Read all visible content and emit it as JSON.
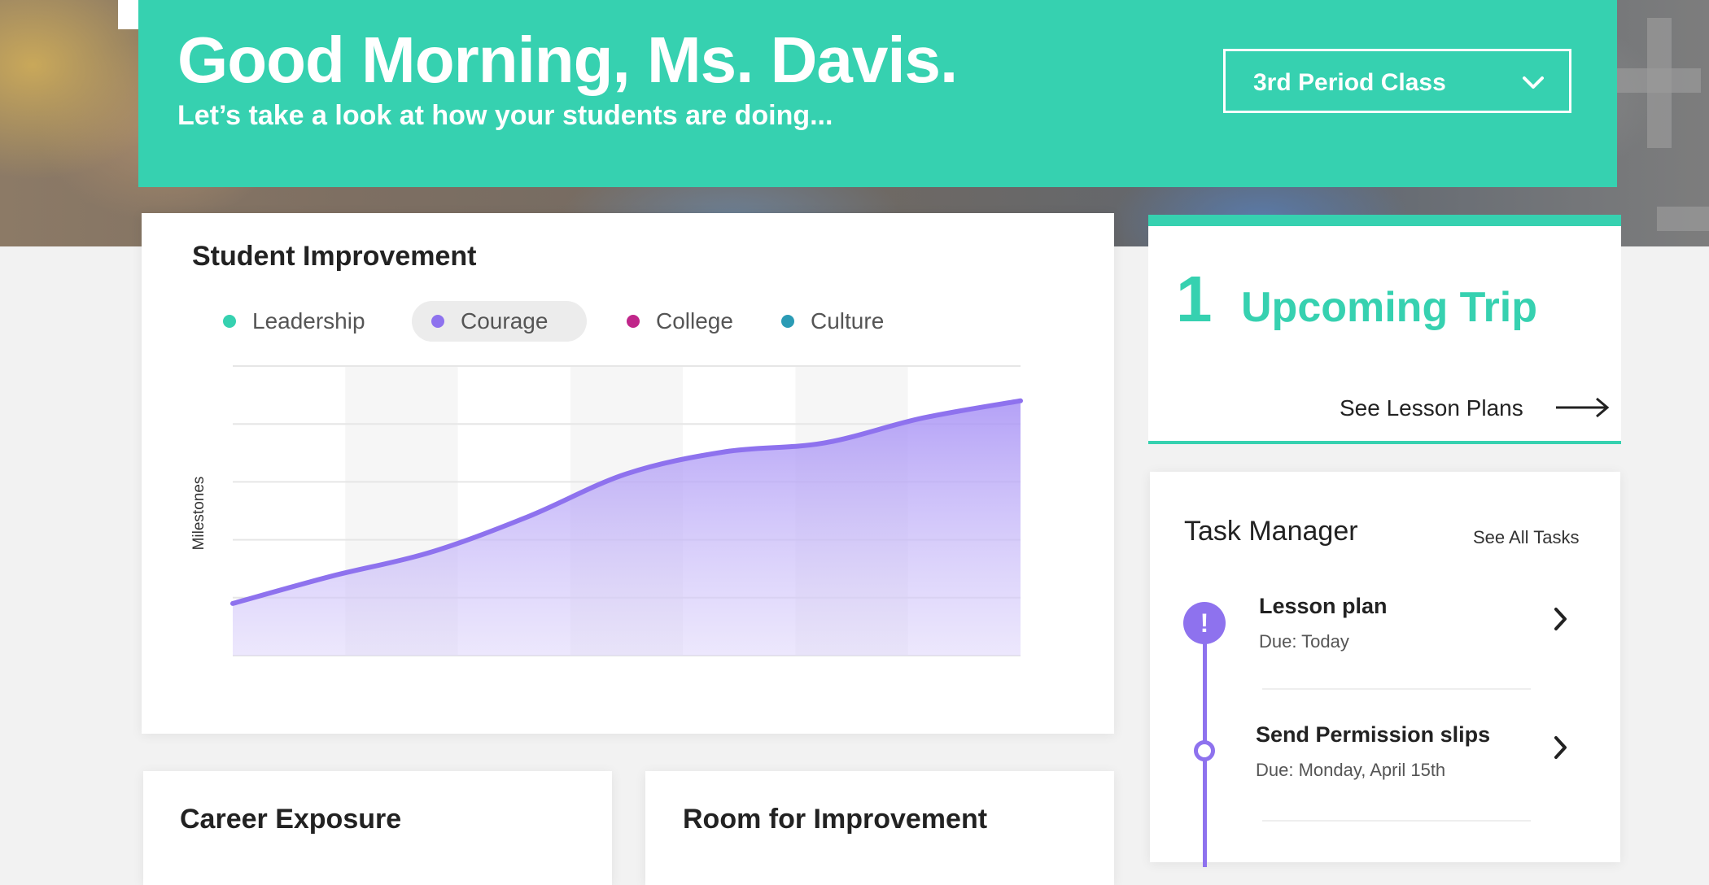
{
  "header": {
    "greeting": "Good Morning, Ms. Davis.",
    "subgreeting": "Let’s take a look at how your students are doing...",
    "class_selector": "3rd Period Class"
  },
  "improvement": {
    "title": "Student Improvement",
    "legend": [
      {
        "label": "Leadership",
        "color": "#36d1b0"
      },
      {
        "label": "Courage",
        "color": "#8e72ee",
        "active": true
      },
      {
        "label": "College",
        "color": "#c0268a"
      },
      {
        "label": "Culture",
        "color": "#2a9bb5"
      }
    ]
  },
  "chart_data": {
    "type": "area",
    "ylabel": "Milestones",
    "xlabel": "",
    "series": [
      {
        "name": "Courage",
        "values": [
          0.9,
          1.37,
          1.78,
          2.4,
          3.14,
          3.52,
          3.67,
          4.1,
          4.4
        ]
      }
    ],
    "ylim": [
      0,
      5
    ],
    "grid": true
  },
  "trip": {
    "count": "1",
    "label": "Upcoming Trip",
    "link": "See Lesson Plans"
  },
  "tasks": {
    "title": "Task Manager",
    "see_all": "See All Tasks",
    "items": [
      {
        "title": "Lesson plan",
        "due": "Due: Today",
        "urgent": true
      },
      {
        "title": "Send Permission slips",
        "due": "Due: Monday, April 15th"
      }
    ]
  },
  "bottom": {
    "career": "Career Exposure",
    "room": "Room for Improvement"
  },
  "colors": {
    "accent": "#36d1b0",
    "purple": "#8e72ee"
  }
}
